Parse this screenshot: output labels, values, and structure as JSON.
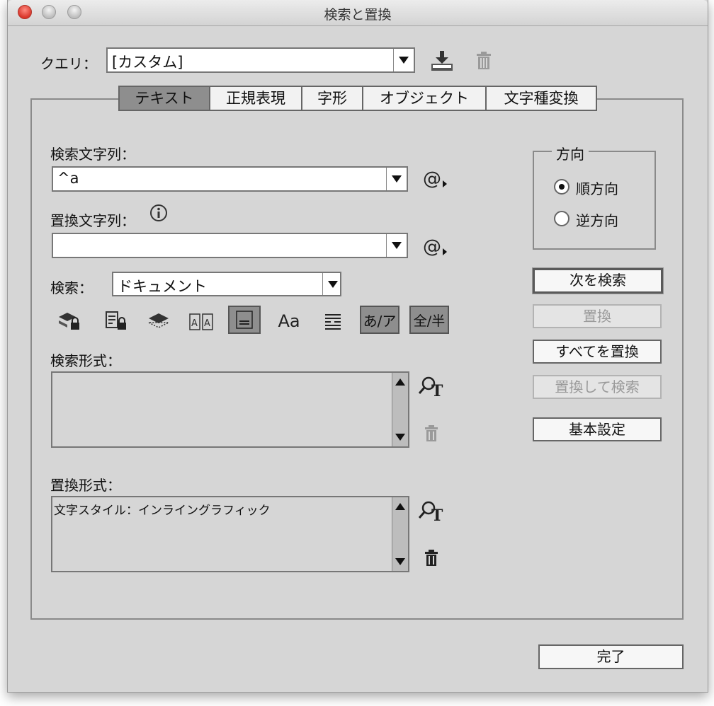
{
  "window": {
    "title": "検索と置換"
  },
  "query": {
    "label": "クエリ：",
    "value": "[カスタム]"
  },
  "tabs": [
    {
      "label": "テキスト",
      "selected": true
    },
    {
      "label": "正規表現",
      "selected": false
    },
    {
      "label": "字形",
      "selected": false
    },
    {
      "label": "オブジェクト",
      "selected": false
    },
    {
      "label": "文字種変換",
      "selected": false
    }
  ],
  "find": {
    "label": "検索文字列：",
    "value": "^a"
  },
  "change": {
    "label": "置換文字列：",
    "value": ""
  },
  "search": {
    "label": "検索：",
    "value": "ドキュメント"
  },
  "options": {
    "toggles": [
      {
        "name": "include-locked-layers",
        "on": false
      },
      {
        "name": "include-locked-stories",
        "on": false
      },
      {
        "name": "include-hidden-layers",
        "on": false
      },
      {
        "name": "include-master-pages",
        "on": false
      },
      {
        "name": "include-footnotes",
        "on": true
      },
      {
        "name": "case-sensitive",
        "on": false,
        "text": "Aa"
      },
      {
        "name": "whole-word",
        "on": false
      },
      {
        "name": "kana-sensitive",
        "on": true,
        "text": "あ/ア"
      },
      {
        "name": "full-half-width-sensitive",
        "on": true,
        "text": "全/半"
      }
    ]
  },
  "find_format": {
    "label": "検索形式：",
    "content": ""
  },
  "change_format": {
    "label": "置換形式：",
    "content": "文字スタイル：インライングラフィック"
  },
  "direction": {
    "legend": "方向",
    "forward": {
      "label": "順方向",
      "checked": true
    },
    "backward": {
      "label": "逆方向",
      "checked": false
    }
  },
  "buttons": {
    "find_next": "次を検索",
    "change": "置換",
    "change_all": "すべてを置換",
    "change_find": "置換して検索",
    "fewer_options": "基本設定",
    "done": "完了"
  },
  "icons": {
    "save_query": "save-query-icon",
    "delete_query": "trash-icon",
    "special_chars": "at-sign-icon",
    "specify_attributes": "search-format-icon",
    "clear_attributes": "trash-icon"
  },
  "colors": {
    "window_bg": "#d6d6d6",
    "selected_tab": "#8e8e8e",
    "close_button": "#d9362b"
  }
}
